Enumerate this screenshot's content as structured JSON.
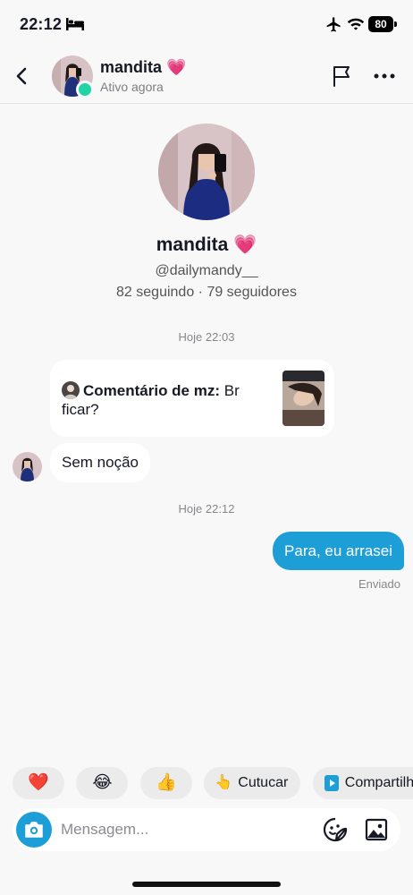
{
  "status_bar": {
    "time": "22:12",
    "battery": "80"
  },
  "header": {
    "name": "mandita 💗",
    "status": "Ativo agora"
  },
  "profile": {
    "name": "mandita 💗",
    "handle": "@dailymandy__",
    "stats": "82 seguindo · 79 seguidores"
  },
  "messages": {
    "timestamp_1": "Hoje 22:03",
    "comment_label": "Comentário de mz:",
    "comment_body": " Br ficar?",
    "received_1": "Sem noção",
    "timestamp_2": "Hoje 22:12",
    "sent_1": "Para, eu arrasei",
    "sent_status": "Enviado"
  },
  "quick_replies": {
    "heart": "❤️",
    "laugh": "😂",
    "thumbs_up": "👍",
    "poke_label": "Cutucar",
    "share_label": "Compartilhar"
  },
  "composer": {
    "placeholder": "Mensagem..."
  },
  "colors": {
    "accent": "#1d9ed6",
    "online": "#20d5a3",
    "background": "#f8f8f8"
  }
}
